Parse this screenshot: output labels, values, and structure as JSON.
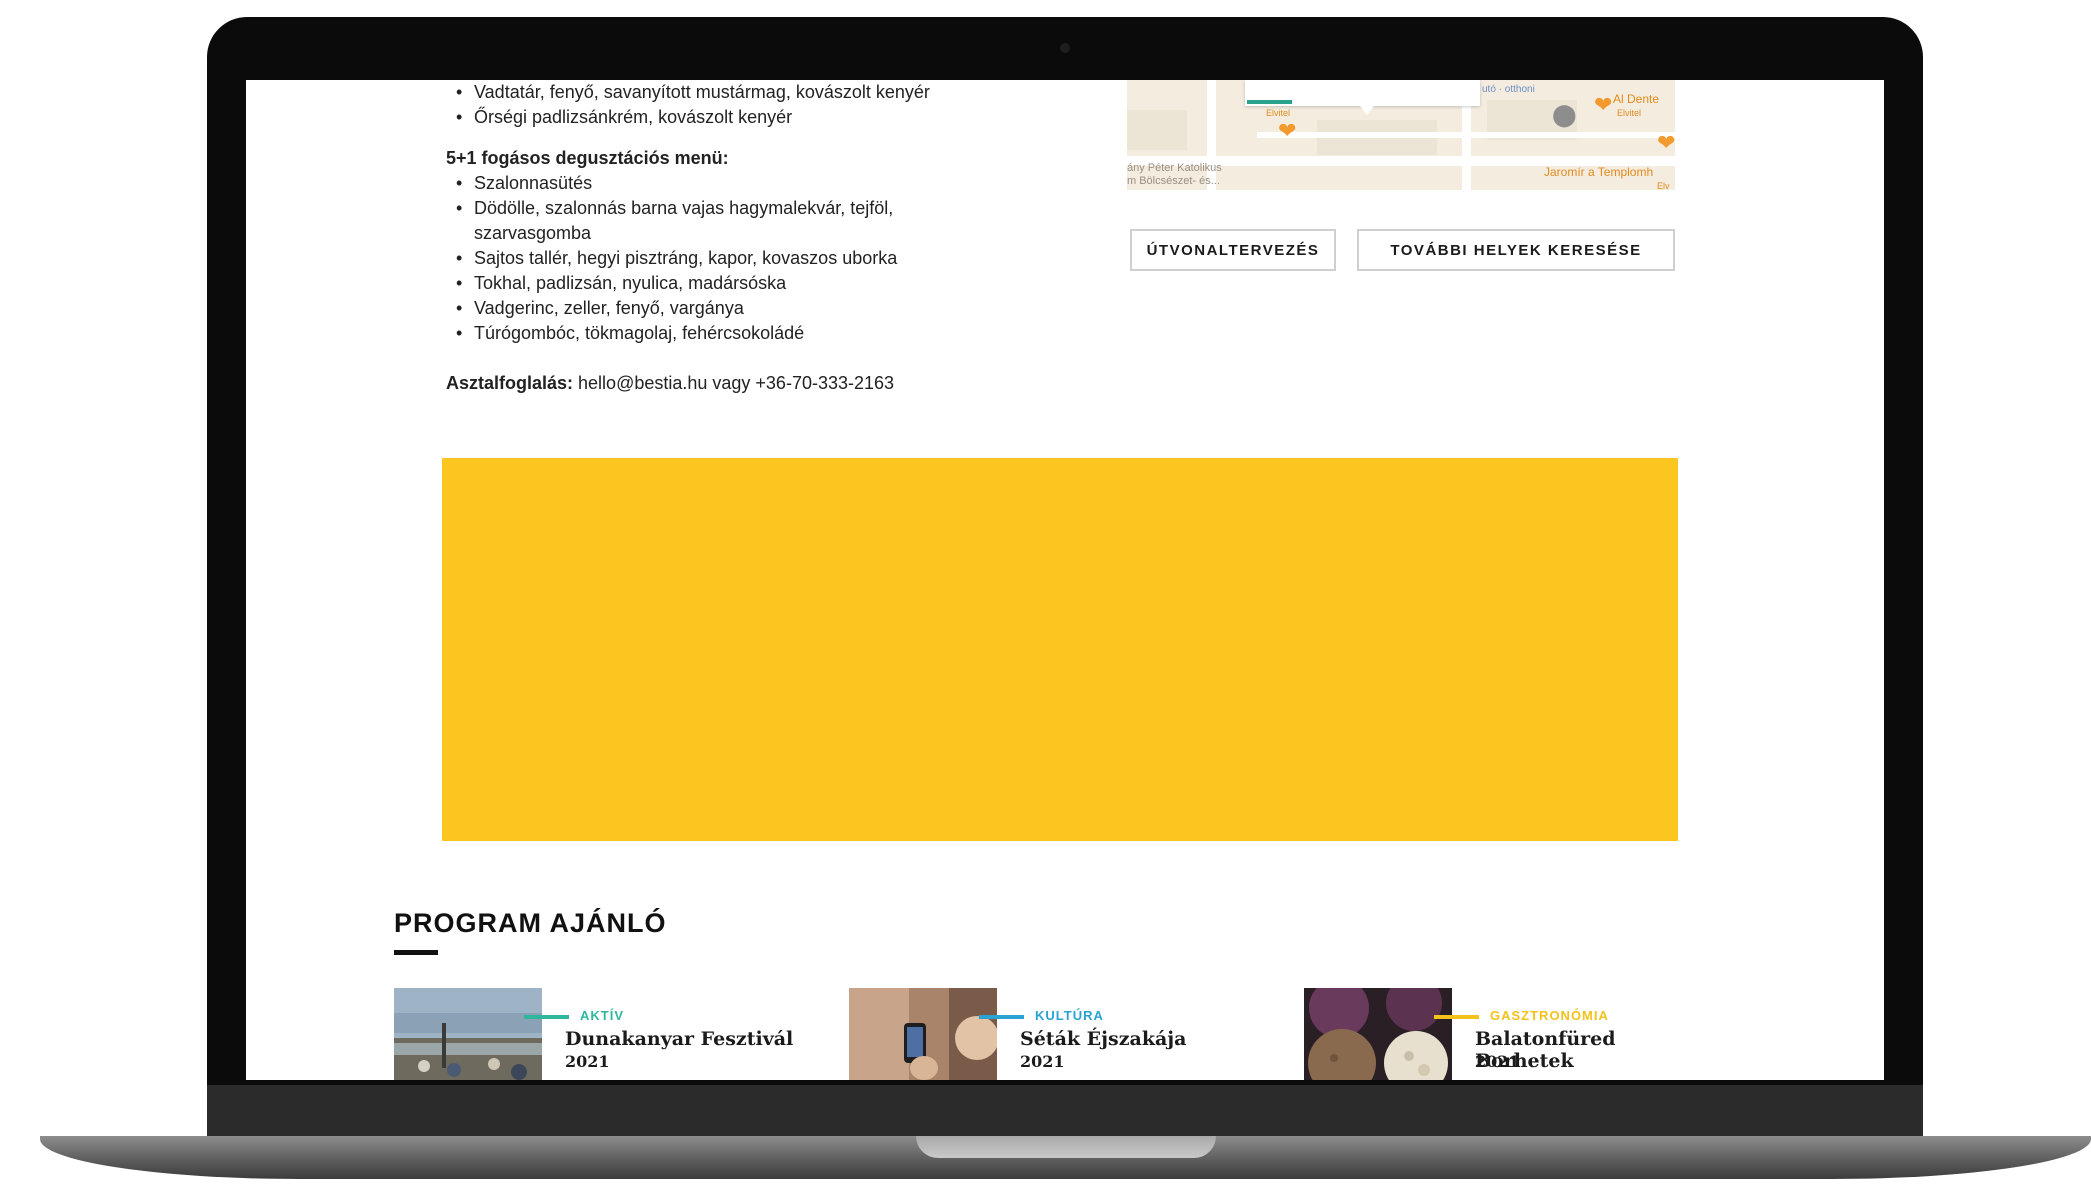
{
  "menu": {
    "previous_items": [
      "Vadtatár, fenyő, savanyított mustármag, kovászolt kenyér",
      "Őrségi padlizsánkrém, kovászolt kenyér"
    ],
    "tasting_menu_heading": "5+1 fogásos degusztációs menü:",
    "tasting_items": [
      "Szalonnasütés",
      "Dödölle, szalonnás barna vajas hagymalekvár, tejföl, szarvasgomba",
      "Sajtos tallér, hegyi pisztráng, kapor, kovaszos uborka",
      "Tokhal, padlizsán, nyulica, madársóska",
      "Vadgerinc, zeller, fenyő, vargánya",
      "Túrógombóc, tökmagolaj, fehércsokoládé"
    ],
    "booking_label": "Asztalfoglalás:",
    "booking_value": " hello@bestia.hu vagy +36-70-333-2163"
  },
  "map": {
    "labels": {
      "ai_dente": "Al Dente",
      "elvitel_1": "Elvitel",
      "elvitel_2": "Elvitel",
      "elvitel_3": "Elv",
      "otthon": "utó · otthoni",
      "church_1": "ány Péter Katolikus",
      "church_2": "m Bölcsészet- és...",
      "jaromir": "Jaromír a Templomh"
    }
  },
  "buttons": {
    "route": "ÚTVONALTERVEZÉS",
    "more_places": "TOVÁBBI HELYEK KERESÉSE"
  },
  "colors": {
    "banner": "#fbc61f",
    "aktiv": "#2fb79c",
    "kultura": "#2aa3d4",
    "gasztronomia": "#f4c21b"
  },
  "program": {
    "title": "PROGRAM AJÁNLÓ",
    "cards": [
      {
        "category": "AKTÍV",
        "title": "Dunakanyar Fesztivál",
        "year": "2021"
      },
      {
        "category": "KULTÚRA",
        "title": "Séták Éjszakája",
        "year": "2021"
      },
      {
        "category": "GASZTRONÓMIA",
        "title": "Balatonfüred Borhetek",
        "year": "2021"
      }
    ]
  }
}
